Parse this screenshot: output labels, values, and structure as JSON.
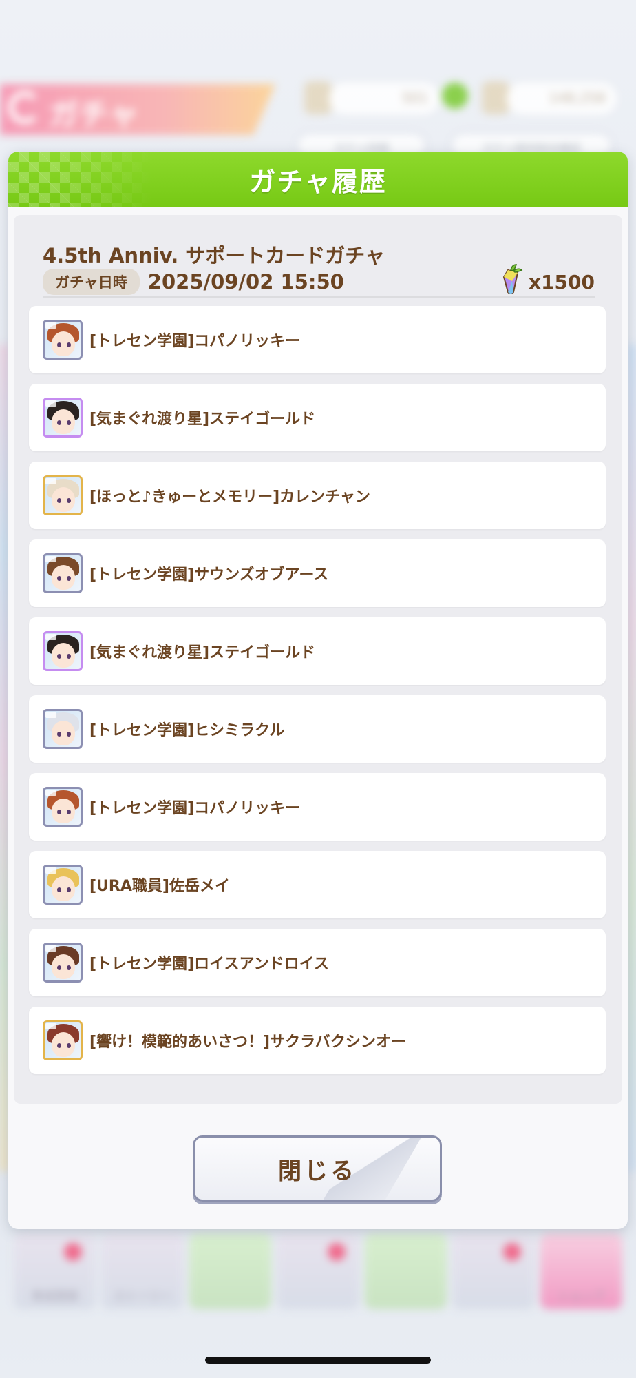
{
  "background": {
    "header_title": "ガチャ",
    "currency_1": "501",
    "currency_2": "148,258",
    "pill_1": "ガチャ詳細",
    "pill_2": "ガチャ提供割合確認",
    "footer_tiles": [
      "育成登録",
      "ストーリー",
      "",
      "",
      "",
      "",
      "ショップ"
    ]
  },
  "modal": {
    "title": "ガチャ履歴",
    "gacha_name": "4.5th Anniv. サポートカードガチャ",
    "date_label": "ガチャ日時",
    "date_value": "2025/09/02 15:50",
    "cost_icon": "carrot-jewel-icon",
    "cost_value": "x1500",
    "close_label": "閉じる"
  },
  "results": [
    {
      "label": "[トレセン学園]コパノリッキー",
      "rarity": "R",
      "hair_color": "#b5562d"
    },
    {
      "label": "[気まぐれ渡り星]ステイゴールド",
      "rarity": "SSR",
      "hair_color": "#2a2320"
    },
    {
      "label": "[ほっと♪きゅーとメモリー]カレンチャン",
      "rarity": "SR",
      "hair_color": "#e8dcc8"
    },
    {
      "label": "[トレセン学園]サウンズオブアース",
      "rarity": "R",
      "hair_color": "#7a4a2a"
    },
    {
      "label": "[気まぐれ渡り星]ステイゴールド",
      "rarity": "SSR",
      "hair_color": "#2a2320"
    },
    {
      "label": "[トレセン学園]ヒシミラクル",
      "rarity": "R",
      "hair_color": "#dfe2ea"
    },
    {
      "label": "[トレセン学園]コパノリッキー",
      "rarity": "R",
      "hair_color": "#b5562d"
    },
    {
      "label": "[URA職員]佐岳メイ",
      "rarity": "R",
      "hair_color": "#e9c25a"
    },
    {
      "label": "[トレセン学園]ロイスアンドロイス",
      "rarity": "R",
      "hair_color": "#6a3b26"
    },
    {
      "label": "[響け！模範的あいさつ！]サクラバクシンオー",
      "rarity": "SR",
      "hair_color": "#8a3a2c"
    }
  ]
}
